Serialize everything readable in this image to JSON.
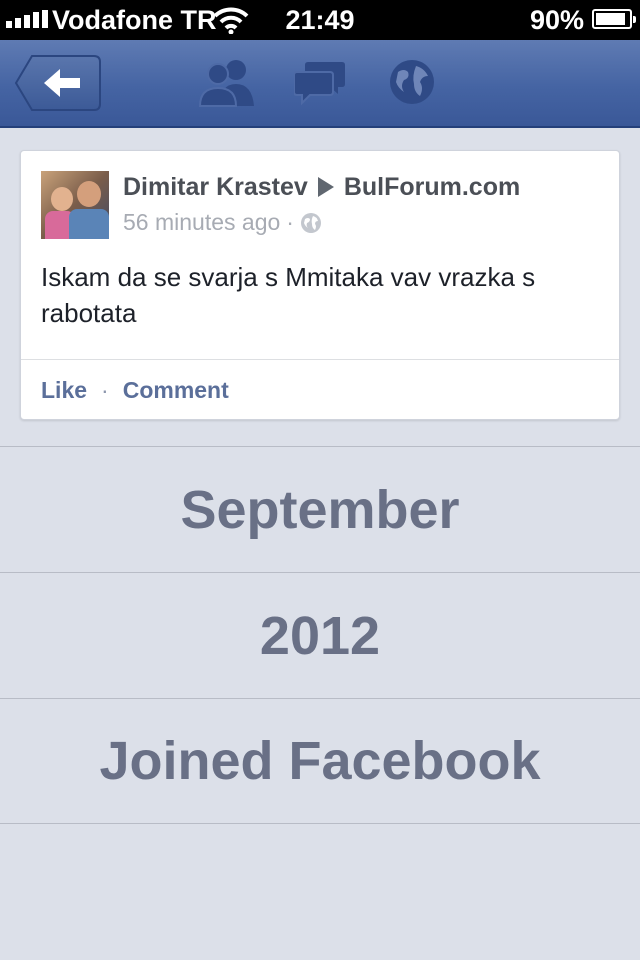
{
  "status_bar": {
    "carrier": "Vodafone TR",
    "time": "21:49",
    "battery_percent": "90%",
    "battery_level": 0.9,
    "icons": [
      "signal-icon",
      "wifi-icon",
      "battery-icon"
    ]
  },
  "navbar": {
    "icons": [
      "back-arrow-icon",
      "friends-icon",
      "messages-icon",
      "globe-icon"
    ],
    "colors": {
      "bar": "#4564a3",
      "icon": "#2f4a86"
    }
  },
  "post": {
    "author": "Dimitar Krastev",
    "target": "BulForum.com",
    "time_ago": "56 minutes ago",
    "separator": "·",
    "privacy_icon": "globe-icon",
    "text": "Iskam da se svarja s Mmitaka vav vrazka s rabotata",
    "actions": {
      "like": "Like",
      "separator": "·",
      "comment": "Comment"
    }
  },
  "timeline": {
    "month": "September",
    "year": "2012",
    "event": "Joined Facebook"
  },
  "colors": {
    "background": "#dce0e9",
    "link": "#5b6f9a",
    "timeline_text": "#697086"
  }
}
